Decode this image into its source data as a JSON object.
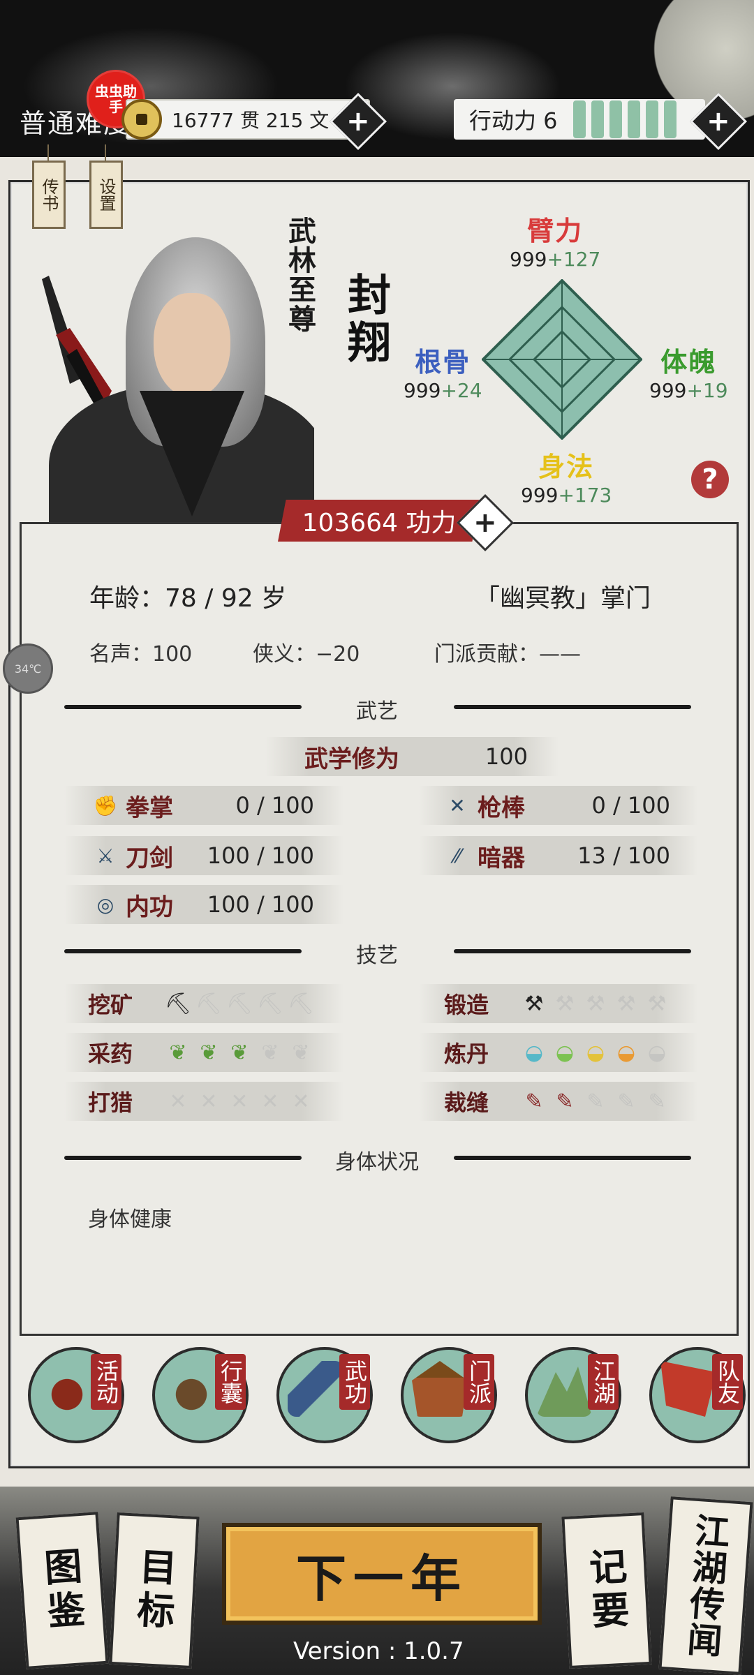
{
  "topbar": {
    "difficulty": "普通难度",
    "badge": "虫虫助手",
    "money": "16777 贯 215 文",
    "action_label": "行动力 6",
    "action_points": 6
  },
  "tags": [
    "传书",
    "设置"
  ],
  "character": {
    "title": "武林至尊",
    "name": "封翔",
    "power": "103664 功力"
  },
  "stats": {
    "top": {
      "label": "臂力",
      "base": "999",
      "bonus": "+127",
      "color": "#d83b3b"
    },
    "left": {
      "label": "根骨",
      "base": "999",
      "bonus": "+24",
      "color": "#3c5fbf"
    },
    "right": {
      "label": "体魄",
      "base": "999",
      "bonus": "+19",
      "color": "#3a9b2e"
    },
    "bottom": {
      "label": "身法",
      "base": "999",
      "bonus": "+173",
      "color": "#e5c11a"
    }
  },
  "info": {
    "age": "年龄：78 / 92 岁",
    "sect": "「幽冥教」掌门",
    "fame": "名声：100",
    "chivalry": "侠义：−20",
    "contribution": "门派贡献：——"
  },
  "sections": {
    "martial": "武艺",
    "craft": "技艺",
    "health": "身体状况"
  },
  "martial_total": {
    "label": "武学修为",
    "value": "100"
  },
  "martial_skills": [
    {
      "name": "拳掌",
      "value": "0 / 100"
    },
    {
      "name": "枪棒",
      "value": "0 / 100"
    },
    {
      "name": "刀剑",
      "value": "100 / 100"
    },
    {
      "name": "暗器",
      "value": "13 / 100"
    },
    {
      "name": "内功",
      "value": "100 / 100"
    }
  ],
  "crafts": [
    {
      "name": "挖矿",
      "level": 1
    },
    {
      "name": "锻造",
      "level": 1
    },
    {
      "name": "采药",
      "level": 3
    },
    {
      "name": "炼丹",
      "level": 4
    },
    {
      "name": "打猎",
      "level": 0
    },
    {
      "name": "裁缝",
      "level": 2
    }
  ],
  "health_status": "身体健康",
  "nav": [
    {
      "label": "活动",
      "icon": "gourd-icon"
    },
    {
      "label": "行囊",
      "icon": "bag-icon"
    },
    {
      "label": "武功",
      "icon": "scroll-icon"
    },
    {
      "label": "门派",
      "icon": "temple-icon"
    },
    {
      "label": "江湖",
      "icon": "mountain-icon"
    },
    {
      "label": "队友",
      "icon": "flag-icon"
    }
  ],
  "bottom": {
    "catalog": "图鉴",
    "goals": "目标",
    "next_year": "下一年",
    "notes": "记要",
    "rumors": "江湖传闻",
    "version": "Version : 1.0.7"
  },
  "temp": "34℃"
}
